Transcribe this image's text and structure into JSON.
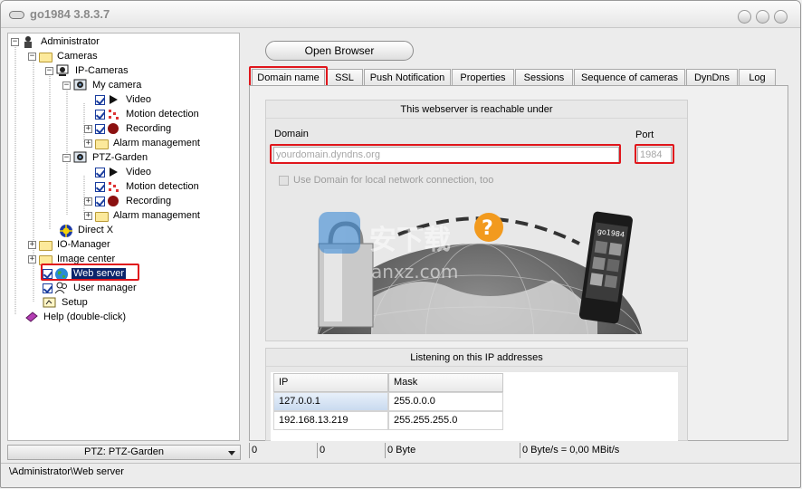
{
  "window": {
    "title": "go1984 3.8.3.7"
  },
  "tree": {
    "items": [
      {
        "label": "Administrator"
      },
      {
        "label": "Cameras"
      },
      {
        "label": "IP-Cameras"
      },
      {
        "label": "My camera"
      },
      {
        "label": "Video"
      },
      {
        "label": "Motion detection"
      },
      {
        "label": "Recording"
      },
      {
        "label": "Alarm management"
      },
      {
        "label": "PTZ-Garden"
      },
      {
        "label": "Video"
      },
      {
        "label": "Motion detection"
      },
      {
        "label": "Recording"
      },
      {
        "label": "Alarm management"
      },
      {
        "label": "Direct X"
      },
      {
        "label": "IO-Manager"
      },
      {
        "label": "Image center"
      },
      {
        "label": "Web server"
      },
      {
        "label": "User manager"
      },
      {
        "label": "Setup"
      },
      {
        "label": "Help (double-click)"
      }
    ]
  },
  "camera_select": {
    "value": "PTZ: PTZ-Garden"
  },
  "statusbar": {
    "path": "\\Administrator\\Web server"
  },
  "toolbar": {
    "open_browser": "Open Browser"
  },
  "tabs": [
    {
      "label": "Domain name"
    },
    {
      "label": "SSL"
    },
    {
      "label": "Push Notification"
    },
    {
      "label": "Properties"
    },
    {
      "label": "Sessions"
    },
    {
      "label": "Sequence of cameras"
    },
    {
      "label": "DynDns"
    },
    {
      "label": "Log"
    }
  ],
  "domain_group": {
    "header": "This webserver is reachable under",
    "domain_label": "Domain",
    "domain_placeholder": "yourdomain.dyndns.org",
    "port_label": "Port",
    "port_value": "1984",
    "checkbox_label": "Use Domain for local network connection, too",
    "watermark_main": "安下载",
    "watermark_sub": "anxz.com",
    "phone_brand": "go1984"
  },
  "ip_group": {
    "header": "Listening on this IP addresses",
    "columns": [
      "IP",
      "Mask"
    ],
    "rows": [
      {
        "ip": "127.0.0.1",
        "mask": "255.0.0.0"
      },
      {
        "ip": "192.168.13.219",
        "mask": "255.255.255.0"
      }
    ]
  },
  "stats": {
    "f1": "0",
    "f2": "0",
    "f3": "0 Byte",
    "f4": "0 Byte/s = 0,00 MBit/s"
  },
  "colors": {
    "accent_red": "#e0161c",
    "selection": "#0a246a"
  }
}
